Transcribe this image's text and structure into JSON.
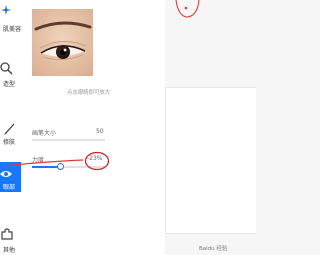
{
  "sidebar": {
    "items": [
      {
        "label": "肌美容",
        "icon": "sparkle-icon"
      },
      {
        "label": "造型",
        "icon": "search-icon"
      },
      {
        "label": "修肤",
        "icon": "brush-icon"
      },
      {
        "label": "眼部",
        "icon": "eye-icon",
        "active": true
      },
      {
        "label": "其他",
        "icon": "puzzle-icon"
      }
    ]
  },
  "panel": {
    "preview_caption": "点击眼睛即可放大",
    "brush_size": {
      "label": "画笔大小",
      "value": "50"
    },
    "strength": {
      "label": "力度",
      "value": "-23%"
    }
  },
  "watermark": "Baidu 经验",
  "colors": {
    "accent": "#1677ff",
    "annotation": "#e53935",
    "annotation_dark": "#c62828"
  }
}
